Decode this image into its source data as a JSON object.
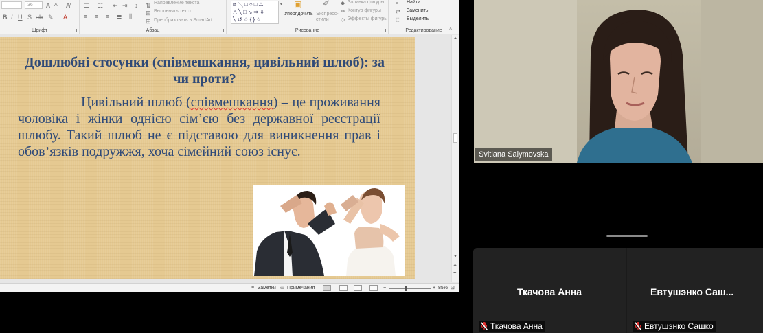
{
  "ribbon": {
    "font_name": "",
    "font_size": "36",
    "font_group_label": "Шрифт",
    "paragraph_group_label": "Абзац",
    "drawing_group_label": "Рисование",
    "editing_group_label": "Редактирование",
    "text_direction": "Направление текста",
    "align_text": "Выровнять текст",
    "convert_smartart": "Преобразовать в SmartArt",
    "arrange": "Упорядочить",
    "quick_styles": "Экспресс-стили",
    "shape_fill": "Заливка фигуры",
    "shape_outline": "Контур фигуры",
    "shape_effects": "Эффекты фигуры",
    "find": "Найти",
    "replace": "Заменить",
    "select": "Выделить"
  },
  "slide": {
    "title": "Дошлюбні стосунки (співмешкання, цивільний шлюб): за чи проти?",
    "body_start": "Цивільний шлюб (",
    "body_underlined": "співмешкання",
    "body_end": ") – це проживання чоловіка і жінки однією сім’єю без державної реєстрації шлюбу. Такий шлюб не є підставою для виникнення прав і обов’язків подружжя, хоча сімейний союз існує."
  },
  "statusbar": {
    "notes": "Заметки",
    "comments": "Примечания",
    "zoom_level": "85%"
  },
  "speaker": {
    "name": "Svitlana Salymovska"
  },
  "participants": [
    {
      "name": "Ткачова Анна",
      "label": "Ткачова Анна",
      "muted": true
    },
    {
      "name": "Евтушэнко  Саш...",
      "label": "Евтушэнко Сашко",
      "muted": true
    }
  ],
  "colors": {
    "slide_text": "#2f4a78",
    "slide_background": "#e5c991",
    "mic_muted": "#e0302f"
  }
}
